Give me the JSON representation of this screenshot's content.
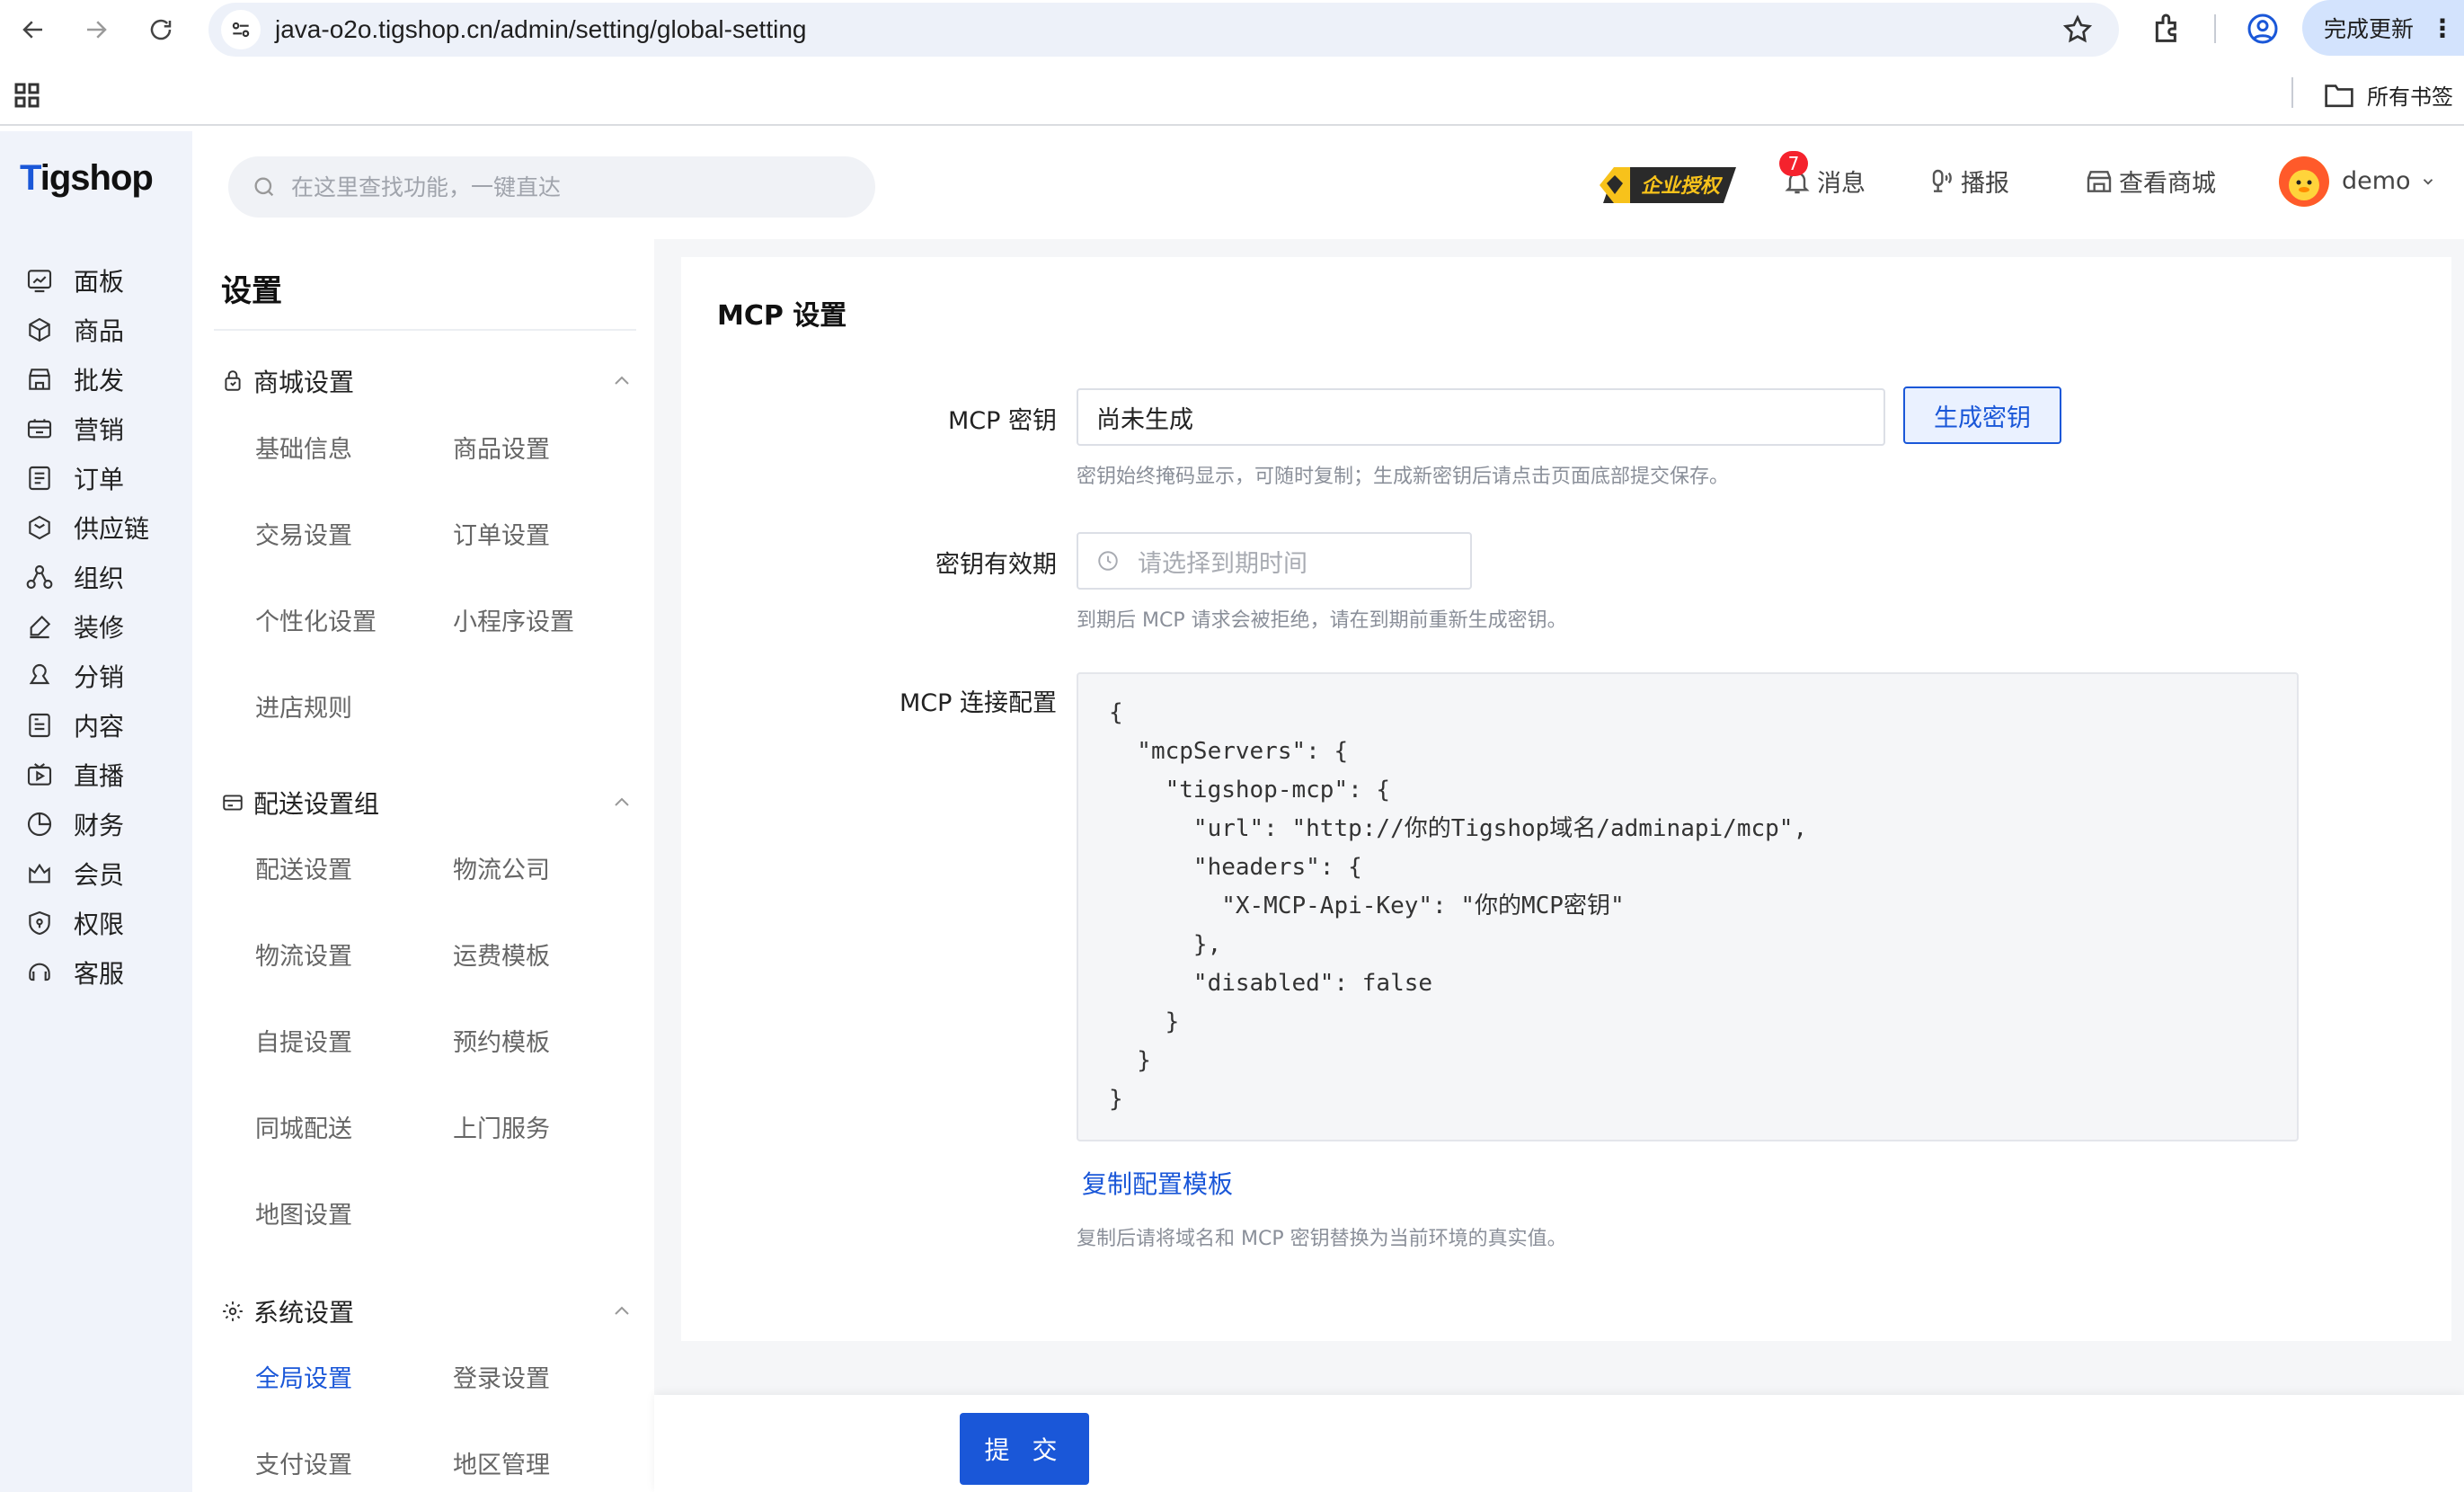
{
  "browser": {
    "url": "java-o2o.tigshop.cn/admin/setting/global-setting",
    "update_label": "完成更新",
    "bookmarks_label": "所有书签"
  },
  "app": {
    "logo_prefix": "T",
    "logo_rest": "igshop",
    "search_placeholder": "在这里查找功能，一键直达",
    "license_label": "企业授权",
    "topbar": {
      "messages": "消息",
      "message_count": "7",
      "broadcast": "播报",
      "view_store": "查看商城",
      "user": "demo"
    },
    "rail": [
      {
        "label": "面板",
        "icon": "dashboard-icon"
      },
      {
        "label": "商品",
        "icon": "cube-icon"
      },
      {
        "label": "批发",
        "icon": "store-icon"
      },
      {
        "label": "营销",
        "icon": "marketing-icon"
      },
      {
        "label": "订单",
        "icon": "order-icon"
      },
      {
        "label": "供应链",
        "icon": "supply-icon"
      },
      {
        "label": "组织",
        "icon": "org-icon"
      },
      {
        "label": "装修",
        "icon": "decorate-icon"
      },
      {
        "label": "分销",
        "icon": "distribution-icon"
      },
      {
        "label": "内容",
        "icon": "content-icon"
      },
      {
        "label": "直播",
        "icon": "live-icon"
      },
      {
        "label": "财务",
        "icon": "finance-icon"
      },
      {
        "label": "会员",
        "icon": "member-icon"
      },
      {
        "label": "权限",
        "icon": "permission-icon"
      },
      {
        "label": "客服",
        "icon": "service-icon"
      }
    ]
  },
  "subnav": {
    "title": "设置",
    "groups": [
      {
        "title": "商城设置",
        "items": [
          "基础信息",
          "商品设置",
          "交易设置",
          "订单设置",
          "个性化设置",
          "小程序设置",
          "进店规则"
        ]
      },
      {
        "title": "配送设置组",
        "items": [
          "配送设置",
          "物流公司",
          "物流设置",
          "运费模板",
          "自提设置",
          "预约模板",
          "同城配送",
          "上门服务",
          "地图设置"
        ]
      },
      {
        "title": "系统设置",
        "items": [
          "全局设置",
          "登录设置",
          "支付设置",
          "地区管理"
        ]
      }
    ],
    "active_item": "全局设置"
  },
  "mcp": {
    "section_title": "MCP 设置",
    "key_label": "MCP 密钥",
    "key_value": "尚未生成",
    "generate_button": "生成密钥",
    "key_hint": "密钥始终掩码显示，可随时复制；生成新密钥后请点击页面底部提交保存。",
    "expire_label": "密钥有效期",
    "expire_placeholder": "请选择到期时间",
    "expire_hint": "到期后 MCP 请求会被拒绝，请在到期前重新生成密钥。",
    "config_label": "MCP 连接配置",
    "config_code": "{\n  \"mcpServers\": {\n    \"tigshop-mcp\": {\n      \"url\": \"http://你的Tigshop域名/adminapi/mcp\",\n      \"headers\": {\n        \"X-MCP-Api-Key\": \"你的MCP密钥\"\n      },\n      \"disabled\": false\n    }\n  }\n}",
    "copy_link": "复制配置模板",
    "copy_hint": "复制后请将域名和 MCP 密钥替换为当前环境的真实值。"
  },
  "footer": {
    "submit": "提 交"
  },
  "colors": {
    "accent": "#1a57d8",
    "badge": "#f5222d"
  }
}
